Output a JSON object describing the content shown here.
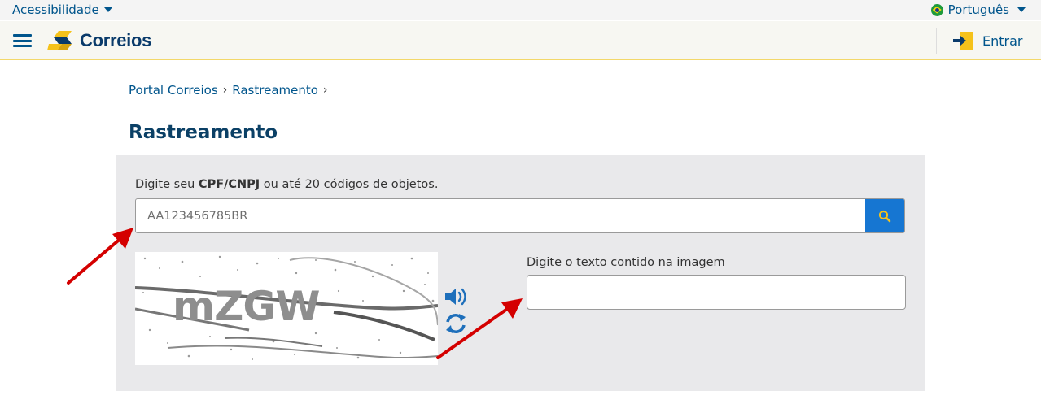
{
  "topbar": {
    "accessibility_label": "Acessibilidade",
    "language_label": "Português"
  },
  "header": {
    "brand": "Correios",
    "login_label": "Entrar"
  },
  "breadcrumb": {
    "items": [
      "Portal Correios",
      "Rastreamento"
    ]
  },
  "page_title": "Rastreamento",
  "tracking": {
    "label_prefix": "Digite seu ",
    "label_bold": "CPF/CNPJ",
    "label_suffix": " ou até 20 códigos de objetos.",
    "placeholder": "AA123456785BR"
  },
  "captcha": {
    "image_text": "mZGW",
    "input_label": "Digite o texto contido na imagem",
    "input_value": ""
  },
  "colors": {
    "brand_blue": "#00558c",
    "title_blue": "#0b4066",
    "search_button": "#1676d2",
    "logo_yellow": "#f5c21b",
    "annotation_red": "#d40000",
    "panel_bg": "#e9e9eb"
  },
  "icons": {
    "menu": "hamburger-menu-icon",
    "search": "magnifier-icon",
    "audio": "speaker-icon",
    "refresh": "refresh-icon",
    "login": "login-arrow-icon"
  }
}
